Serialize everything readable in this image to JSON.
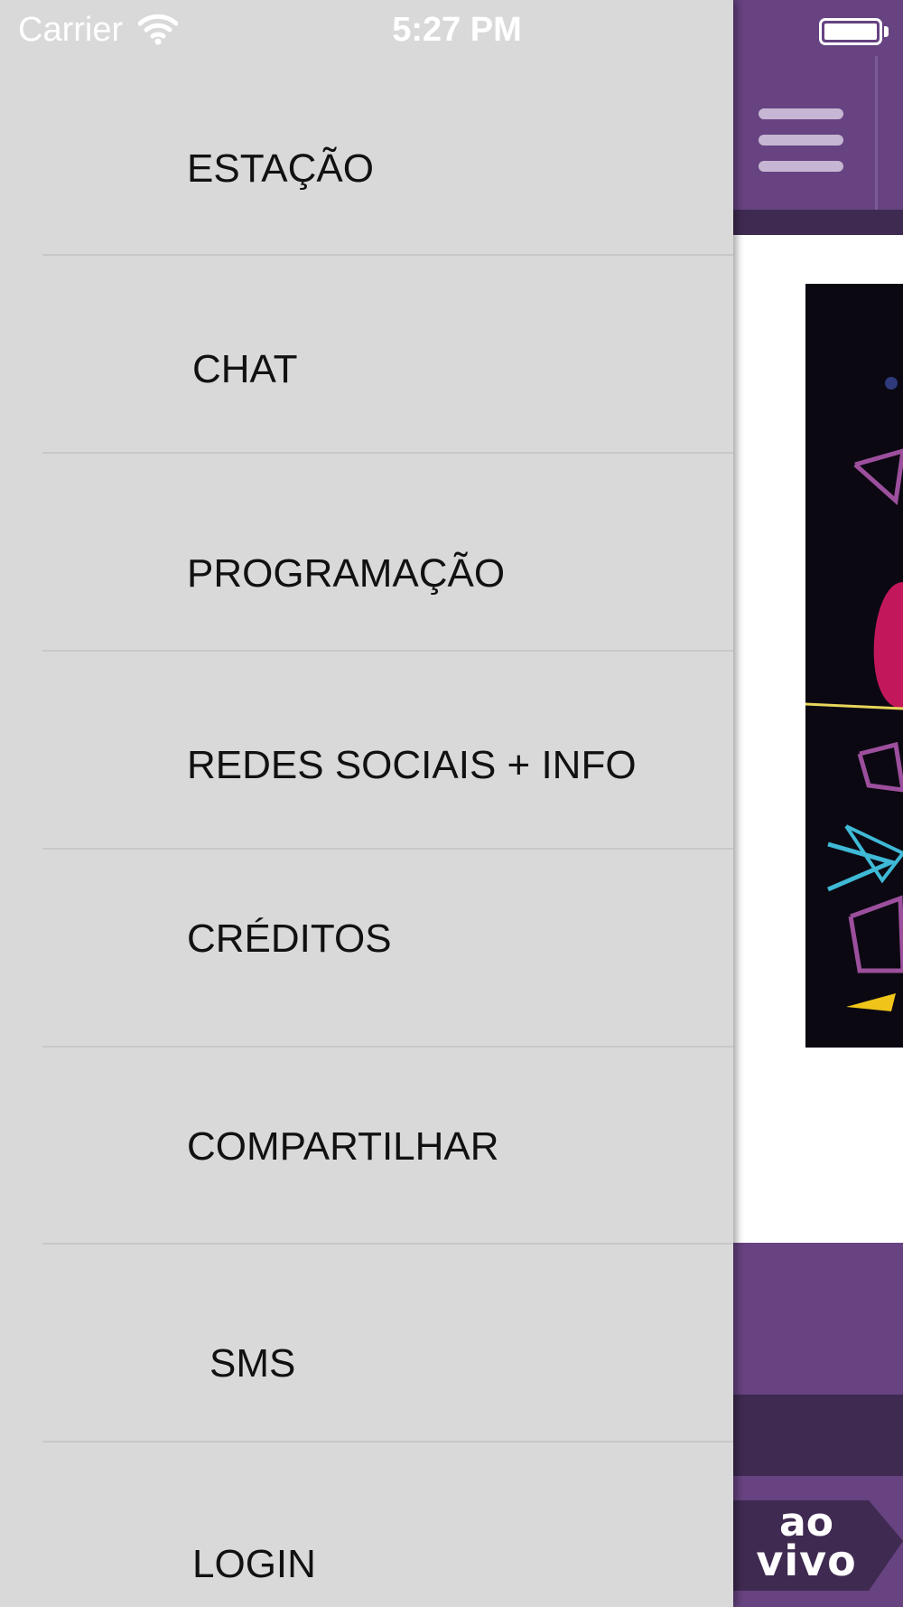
{
  "status_bar": {
    "carrier": "Carrier",
    "time": "5:27 PM"
  },
  "drawer": {
    "items": [
      {
        "label": "ESTAÇÃO"
      },
      {
        "label": "CHAT"
      },
      {
        "label": "PROGRAMAÇÃO"
      },
      {
        "label": "REDES SOCIAIS + INFO"
      },
      {
        "label": "CRÉDITOS"
      },
      {
        "label": "COMPARTILHAR"
      },
      {
        "label": "SMS"
      },
      {
        "label": "LOGIN"
      }
    ]
  },
  "main": {
    "menu_icon": "hamburger-menu-icon",
    "live_badge": {
      "line1": "ao",
      "line2": "vivo"
    }
  },
  "colors": {
    "brand_purple": "#674381",
    "brand_dark_purple": "#3f2a51",
    "drawer_background": "#d9d9d9",
    "menu_text": "#111111",
    "accent_pink": "#c2185b",
    "accent_cyan": "#3fb9d6"
  }
}
